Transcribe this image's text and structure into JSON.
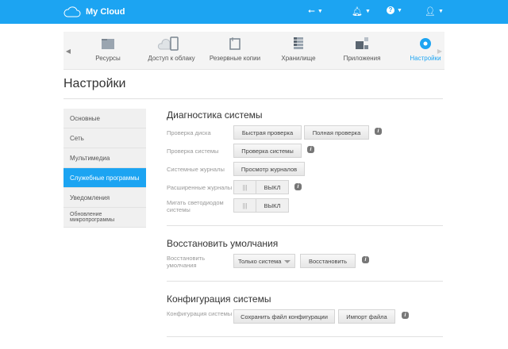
{
  "header": {
    "app_name": "My Cloud",
    "icons": [
      "usb-icon",
      "bell-icon",
      "help-icon",
      "user-icon"
    ],
    "accent": "#1ca4f2"
  },
  "nav": {
    "tabs": [
      {
        "label": "Ресурсы"
      },
      {
        "label": "Доступ к облаку"
      },
      {
        "label": "Резервные копии"
      },
      {
        "label": "Хранилище"
      },
      {
        "label": "Приложения"
      },
      {
        "label": "Настройки",
        "active": true
      }
    ]
  },
  "page": {
    "title": "Настройки"
  },
  "sidebar": {
    "items": [
      {
        "label": "Основные"
      },
      {
        "label": "Сеть"
      },
      {
        "label": "Мультимедиа"
      },
      {
        "label": "Служебные программы",
        "active": true
      },
      {
        "label": "Уведомления"
      },
      {
        "label": "Обновление микропрограммы"
      }
    ]
  },
  "diagnostics": {
    "title": "Диагностика системы",
    "disk_check_label": "Проверка диска",
    "quick_check": "Быстрая проверка",
    "full_check": "Полная проверка",
    "system_check_label": "Проверка системы",
    "system_check": "Проверка системы",
    "logs_label": "Системные журналы",
    "view_logs": "Просмотр журналов",
    "ext_logs_label": "Расширенные журналы",
    "ext_logs_state": "ВЫКЛ",
    "led_label": "Мигать светодиодом системы",
    "led_state": "ВЫКЛ"
  },
  "restore": {
    "title": "Восстановить умолчания",
    "label": "Восстановить умолчания",
    "select_value": "Только система",
    "button": "Восстановить"
  },
  "config": {
    "title": "Конфигурация системы",
    "label": "Конфигурация системы",
    "save": "Сохранить файл конфигурации",
    "import": "Импорт файла"
  },
  "info_glyph": "i"
}
